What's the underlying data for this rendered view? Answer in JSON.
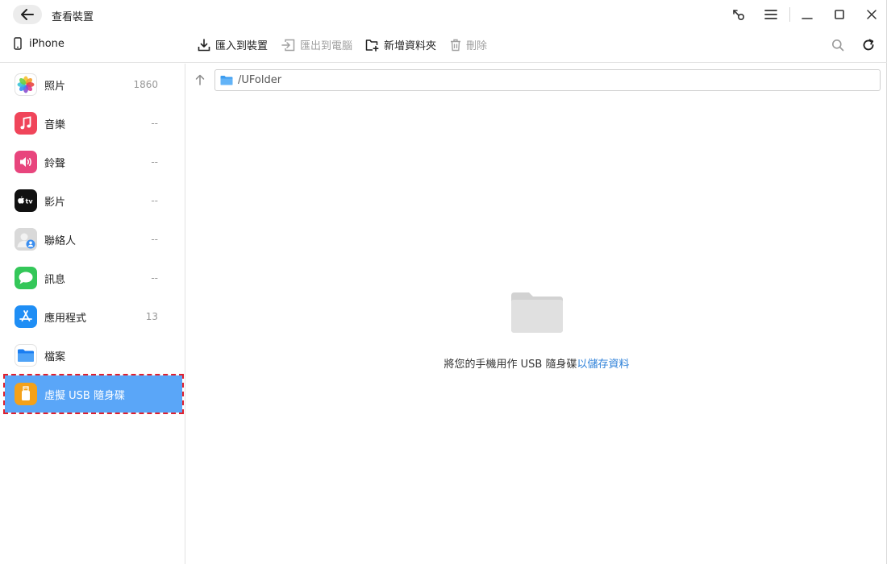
{
  "titlebar": {
    "title": "查看裝置",
    "icons": [
      "back-arrow-icon",
      "connect-icon",
      "menu-icon",
      "minimize-icon",
      "maximize-icon",
      "close-icon"
    ]
  },
  "toolbar": {
    "device_name": "iPhone",
    "import_label": "匯入到裝置",
    "export_label": "匯出到電腦",
    "new_folder_label": "新增資料夾",
    "delete_label": "刪除"
  },
  "sidebar": {
    "items": [
      {
        "label": "照片",
        "count": "1860",
        "icon": "photos-icon"
      },
      {
        "label": "音樂",
        "count": "--",
        "icon": "music-icon"
      },
      {
        "label": "鈴聲",
        "count": "--",
        "icon": "ringtone-icon"
      },
      {
        "label": "影片",
        "count": "--",
        "icon": "tv-icon"
      },
      {
        "label": "聯絡人",
        "count": "--",
        "icon": "contacts-icon"
      },
      {
        "label": "訊息",
        "count": "--",
        "icon": "messages-icon"
      },
      {
        "label": "應用程式",
        "count": "13",
        "icon": "appstore-icon"
      },
      {
        "label": "檔案",
        "count": "",
        "icon": "files-icon"
      },
      {
        "label": "虛擬 USB 隨身碟",
        "count": "",
        "icon": "usb-drive-icon",
        "active": true
      }
    ]
  },
  "main": {
    "path": "/UFolder",
    "empty_message": "將您的手機用作 USB 隨身碟",
    "empty_link": "以儲存資料"
  },
  "colors": {
    "active": "#5aa6f8",
    "highlight_outline": "#e0202e",
    "link": "#2b7fd8"
  }
}
